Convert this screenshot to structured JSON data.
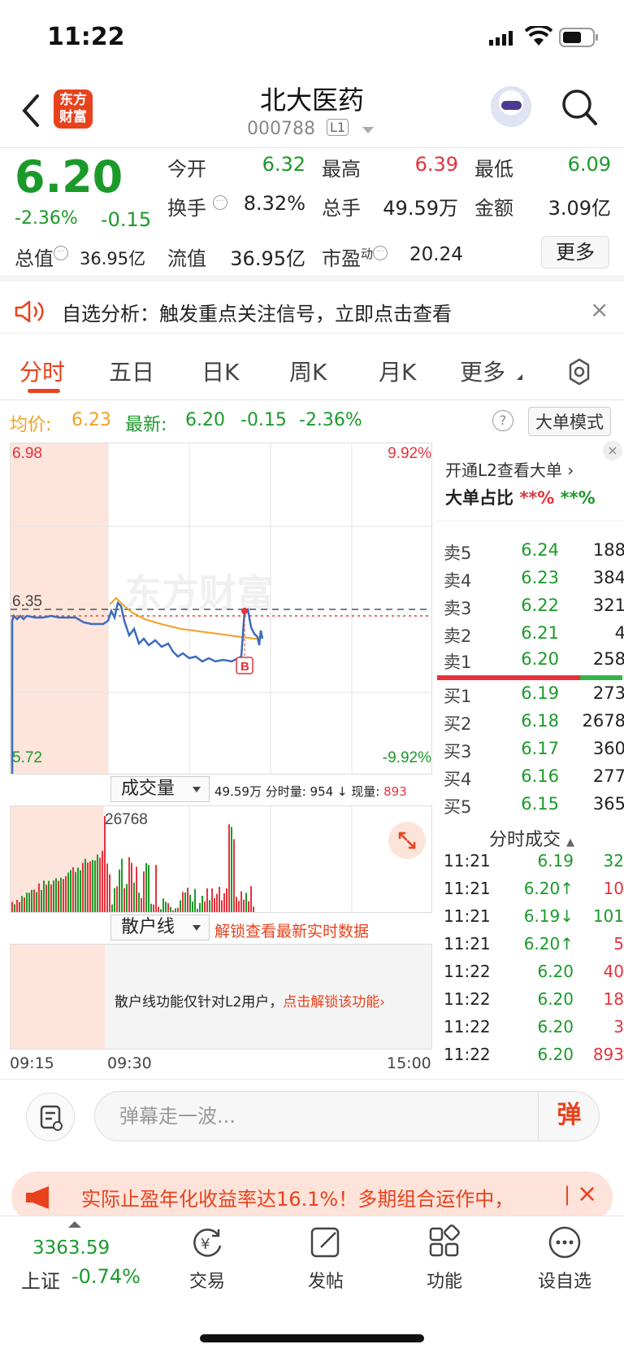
{
  "status": {
    "time": "11:22"
  },
  "header": {
    "stock_name": "北大医药",
    "stock_code": "000788",
    "level_badge": "L1",
    "logo_text_1": "东方",
    "logo_text_2": "财富"
  },
  "quote": {
    "price": "6.20",
    "change_pct": "-2.36%",
    "change_abs": "-0.15",
    "open_label": "今开",
    "open": "6.32",
    "high_label": "最高",
    "high": "6.39",
    "low_label": "最低",
    "low": "6.09",
    "turnover_label": "换手",
    "turnover": "8.32%",
    "volume_label": "总手",
    "volume": "49.59万",
    "amount_label": "金额",
    "amount": "3.09亿",
    "mktcap_label": "总值",
    "mktcap": "36.95亿",
    "float_label": "流值",
    "float_cap": "36.95亿",
    "pe_label": "市盈",
    "pe_sup": "动",
    "pe": "20.24",
    "more_label": "更多"
  },
  "alert": {
    "text": "自选分析：触发重点关注信号，立即点击查看",
    "close": "×"
  },
  "tabs": [
    {
      "label": "分时"
    },
    {
      "label": "五日"
    },
    {
      "label": "日K"
    },
    {
      "label": "周K"
    },
    {
      "label": "月K"
    },
    {
      "label": "更多"
    }
  ],
  "info_row": {
    "avg_label": "均价:",
    "avg": "6.23",
    "latest_label": "最新:",
    "latest": "6.20",
    "change": "-0.15",
    "change_pct": "-2.36%",
    "help": "?",
    "big_order_mode": "大单模式"
  },
  "price_chart": {
    "y_max": "6.98",
    "y_ref": "6.35",
    "y_min": "5.72",
    "pct_max": "9.92%",
    "pct_min": "-9.92%",
    "marker": "B",
    "watermark": "东方财富"
  },
  "volume": {
    "select_label": "成交量",
    "info": "49.59万 分时量: 954 ↓ 现量:",
    "current": "893",
    "peak": "26768"
  },
  "retail": {
    "select_label": "散户线",
    "unlock": "解锁查看最新实时数据",
    "msg": "散户线功能仅针对L2用户，",
    "msg_link": "点击解锁该功能"
  },
  "time_axis": {
    "start": "09:15",
    "mid": "09:30",
    "end": "15:00"
  },
  "right_panel": {
    "l2_link": "开通L2查看大单",
    "big_ratio_label": "大单占比",
    "big_ratio_red": "**%",
    "big_ratio_green": "**%",
    "asks": [
      {
        "label": "卖5",
        "price": "6.24",
        "vol": "188"
      },
      {
        "label": "卖4",
        "price": "6.23",
        "vol": "384"
      },
      {
        "label": "卖3",
        "price": "6.22",
        "vol": "321"
      },
      {
        "label": "卖2",
        "price": "6.21",
        "vol": "4"
      },
      {
        "label": "卖1",
        "price": "6.20",
        "vol": "258"
      }
    ],
    "bids": [
      {
        "label": "买1",
        "price": "6.19",
        "vol": "273"
      },
      {
        "label": "买2",
        "price": "6.18",
        "vol": "2678"
      },
      {
        "label": "买3",
        "price": "6.17",
        "vol": "360"
      },
      {
        "label": "买4",
        "price": "6.16",
        "vol": "277"
      },
      {
        "label": "买5",
        "price": "6.15",
        "vol": "365"
      }
    ],
    "ticks_header": "分时成交",
    "ticks": [
      {
        "time": "11:21",
        "price": "6.19",
        "vol": "32"
      },
      {
        "time": "11:21",
        "price": "6.20↑",
        "vol": "10"
      },
      {
        "time": "11:21",
        "price": "6.19↓",
        "vol": "101"
      },
      {
        "time": "11:21",
        "price": "6.20↑",
        "vol": "5"
      },
      {
        "time": "11:22",
        "price": "6.20",
        "vol": "40"
      },
      {
        "time": "11:22",
        "price": "6.20",
        "vol": "18"
      },
      {
        "time": "11:22",
        "price": "6.20",
        "vol": "3"
      },
      {
        "time": "11:22",
        "price": "6.20",
        "vol": "893"
      }
    ]
  },
  "comment_bar": {
    "placeholder": "弹幕走一波...",
    "danmu_btn": "弹"
  },
  "ad": {
    "text": "实际止盈年化收益率达16.1%！多期组合运作中，",
    "sep": "|",
    "close": "×"
  },
  "bottom_nav": {
    "index_value": "3363.59",
    "index_name": "上证",
    "index_change": "-0.74%",
    "items": [
      {
        "label": "交易"
      },
      {
        "label": "发帖"
      },
      {
        "label": "功能"
      },
      {
        "label": "设自选"
      }
    ]
  },
  "colors": {
    "up": "#e5323d",
    "down": "#1b9a2a",
    "avg": "#f0a123",
    "price_line": "#3a6cc0",
    "accent": "#e8421d"
  }
}
